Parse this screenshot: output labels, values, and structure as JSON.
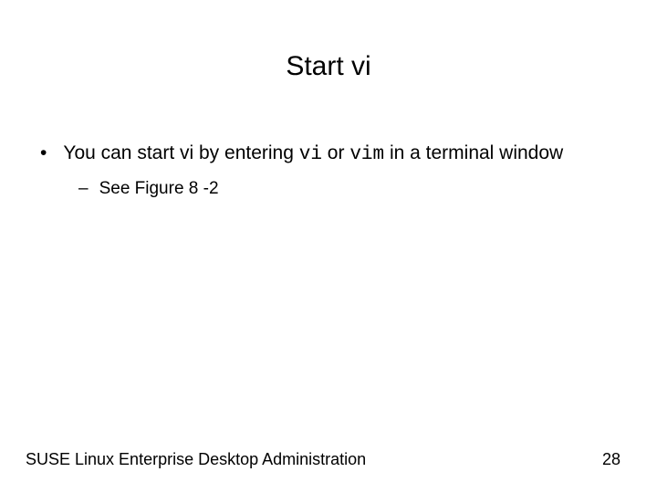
{
  "title": "Start vi",
  "bullet": {
    "pre": "You can start vi by entering ",
    "code1": "vi",
    "mid": " or ",
    "code2": "vim",
    "post": " in a terminal window"
  },
  "subbullet": "See Figure 8 -2",
  "footer": {
    "left": "SUSE Linux Enterprise Desktop Administration",
    "page": "28"
  }
}
